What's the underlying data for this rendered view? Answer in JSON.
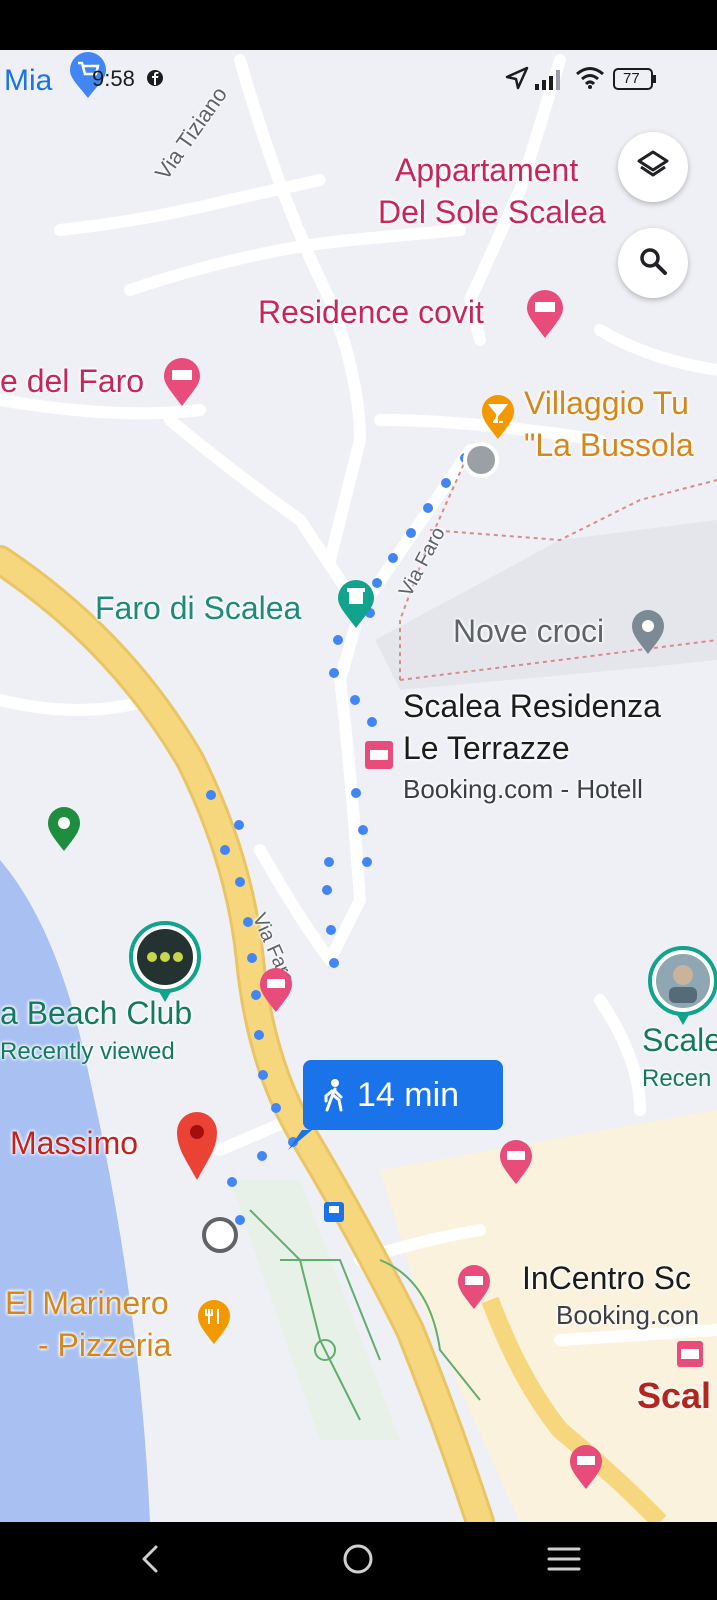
{
  "status_bar": {
    "carrier": "Mia",
    "time": "9:58",
    "battery": "77"
  },
  "map": {
    "streets": {
      "via_tiziano": "Via Tiziano",
      "via_faro_upper": "Via Faro",
      "via_faro_lower": "Via Faro"
    },
    "places": {
      "appartament_line1": "Appartament",
      "appartament_line2": "Del Sole Scalea",
      "residence_covit": "Residence covit",
      "del_faro": "e del Faro",
      "villaggio_line1": "Villaggio Tu",
      "villaggio_line2": "\"La Bussola",
      "faro_di_scalea": "Faro di Scalea",
      "nove_croci": "Nove croci",
      "residenza_line1": "Scalea Residenza",
      "residenza_line2": "Le Terrazze",
      "residenza_sub": "Booking.com - Hotell",
      "beach_club": "a Beach Club",
      "beach_club_sub": "Recently viewed",
      "massimo": "Massimo",
      "marinero_line1": "El Marinero",
      "marinero_line2": "- Pizzeria",
      "incentro": "InCentro Sc",
      "incentro_sub": "Booking.con",
      "scalea_right": "Scale",
      "scalea_right_sub": "Recen",
      "scalea_town": "Scal"
    },
    "route_chip": {
      "duration": "14 min",
      "mode_icon": "walking-person-icon"
    },
    "colors": {
      "road_major": "#f6d77e",
      "water": "#a8c0f2",
      "route": "#4285f4",
      "poi_red": "#c8265a",
      "chip": "#1a73e8"
    }
  },
  "controls": {
    "layers_icon": "layers-icon",
    "search_icon": "search-icon"
  },
  "nav": {
    "back_icon": "back-icon",
    "home_icon": "home-icon",
    "menu_icon": "recents-icon"
  }
}
